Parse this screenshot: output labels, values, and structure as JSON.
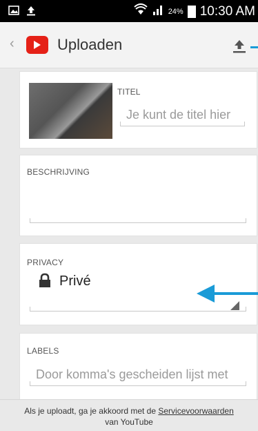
{
  "status_bar": {
    "battery_percent": "24%",
    "time": "10:30 AM"
  },
  "app_bar": {
    "title": "Uploaden"
  },
  "title_field": {
    "label": "TITEL",
    "placeholder": "Je kunt de titel hier"
  },
  "description_field": {
    "label": "BESCHRIJVING"
  },
  "privacy_field": {
    "label": "PRIVACY",
    "value": "Privé"
  },
  "labels_field": {
    "label": "LABELS",
    "placeholder": "Door komma's gescheiden lijst met"
  },
  "footer": {
    "text_before": "Als je uploadt, ga je akkoord met de ",
    "link": "Servicevoorwaarden",
    "text_after": "van YouTube"
  },
  "colors": {
    "accent": "#1a9bd7",
    "youtube_red": "#e52117"
  }
}
